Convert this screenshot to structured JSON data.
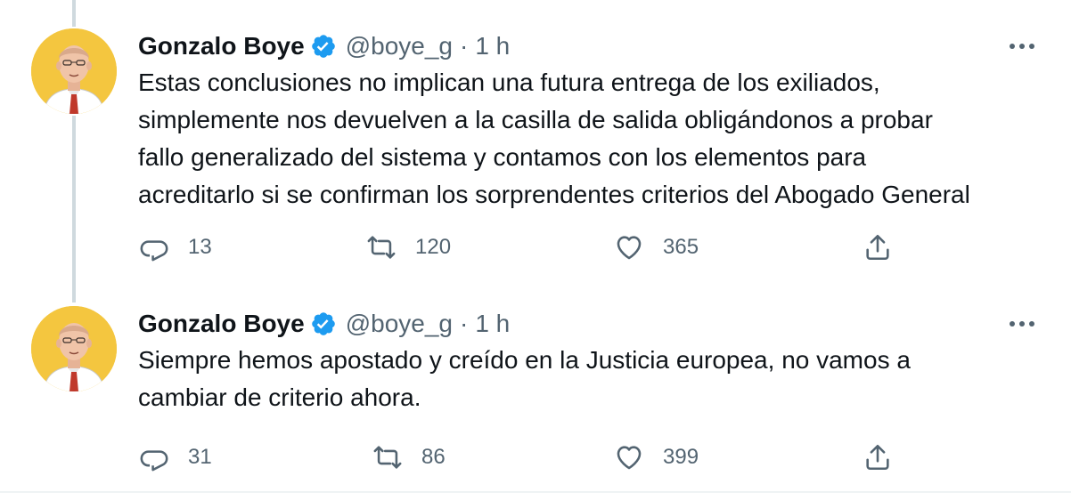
{
  "tweets": [
    {
      "author": {
        "name": "Gonzalo Boye",
        "handle": "@boye_g",
        "verified": true,
        "avatar": "caricature-avatar-icon"
      },
      "separator": "·",
      "time": "1 h",
      "text_lines": [
        "Estas conclusiones no implican una futura entrega de los exiliados,",
        "simplemente nos devuelven a la casilla de salida obligándonos a probar",
        "fallo generalizado del sistema y contamos con los elementos para",
        "acreditarlo si se confirman los sorprendentes criterios del Abogado General"
      ],
      "actions": {
        "replies": "13",
        "retweets": "120",
        "likes": "365"
      }
    },
    {
      "author": {
        "name": "Gonzalo Boye",
        "handle": "@boye_g",
        "verified": true,
        "avatar": "caricature-avatar-icon"
      },
      "separator": "·",
      "time": "1 h",
      "text_lines": [
        "Siempre hemos apostado y creído en la Justicia europea, no vamos a",
        "cambiar de criterio ahora."
      ],
      "actions": {
        "replies": "31",
        "retweets": "86",
        "likes": "399"
      }
    }
  ],
  "icons": {
    "more": "more-horizontal-icon",
    "reply": "reply-icon",
    "retweet": "retweet-icon",
    "like": "like-icon",
    "share": "share-icon",
    "verified": "verified-badge-icon"
  },
  "colors": {
    "text": "#0f1419",
    "secondary": "#536471",
    "verified": "#1d9bf0",
    "thread_line": "#cfd9de",
    "avatar_bg": "#f4c63f"
  }
}
